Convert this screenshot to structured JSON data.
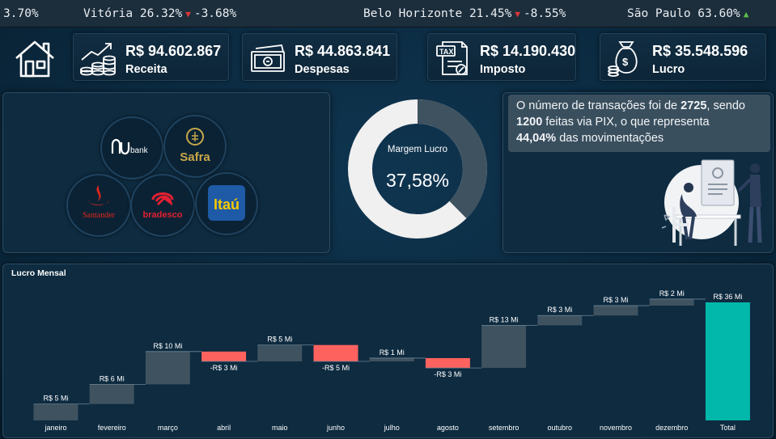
{
  "ticker": {
    "items": [
      {
        "text": "3.70%",
        "dir": "none"
      },
      {
        "text": "Vitória 26.32%",
        "dir": "down",
        "change": "-3.68%"
      },
      {
        "text": "Belo Horizonte 21.45%",
        "dir": "down",
        "change": "-8.55%"
      },
      {
        "text": "São Paulo 63.60%",
        "dir": "up",
        "change": ""
      }
    ]
  },
  "kpis": [
    {
      "value": "R$ 94.602.867",
      "label": "Receita",
      "icon": "revenue-growth-icon"
    },
    {
      "value": "R$ 44.863.841",
      "label": "Despesas",
      "icon": "cash-bill-icon"
    },
    {
      "value": "R$ 14.190.430",
      "label": "Imposto",
      "icon": "tax-document-icon"
    },
    {
      "value": "R$ 35.548.596",
      "label": "Lucro",
      "icon": "money-bag-icon"
    }
  ],
  "banks": {
    "nubank": "bank",
    "safra": "Safra",
    "santander": "Santander",
    "bradesco": "bradesco",
    "itau": "Itaú"
  },
  "margin": {
    "title": "Margem Lucro",
    "value": "37,58%",
    "fraction": 0.3758
  },
  "transactions": {
    "line1_pre": "O número de transações foi de ",
    "total": "2725",
    "line1_post": ", sendo",
    "pix": "1200",
    "line2_post": " feitas via PIX, o que representa",
    "percent": "44,04%",
    "line3_post": " das movimentações"
  },
  "chart_data": {
    "type": "waterfall",
    "title": "Lucro Mensal",
    "categories": [
      "janeiro",
      "fevereiro",
      "março",
      "abril",
      "maio",
      "junho",
      "julho",
      "agosto",
      "setembro",
      "outubro",
      "novembro",
      "dezembro",
      "Total"
    ],
    "values": [
      5,
      6,
      10,
      -3,
      5,
      -5,
      1,
      -3,
      13,
      3,
      3,
      2,
      36
    ],
    "labels": [
      "R$ 5 Mi",
      "R$ 6 Mi",
      "R$ 10 Mi",
      "-R$ 3 Mi",
      "R$ 5 Mi",
      "-R$ 5 Mi",
      "R$ 1 Mi",
      "-R$ 3 Mi",
      "R$ 13 Mi",
      "R$ 3 Mi",
      "R$ 3 Mi",
      "R$ 2 Mi",
      "R$ 36 Mi"
    ],
    "ylim": [
      0,
      36
    ],
    "colors": {
      "increase": "#3e5260",
      "decrease": "#fd625e",
      "total": "#01b8aa"
    }
  }
}
